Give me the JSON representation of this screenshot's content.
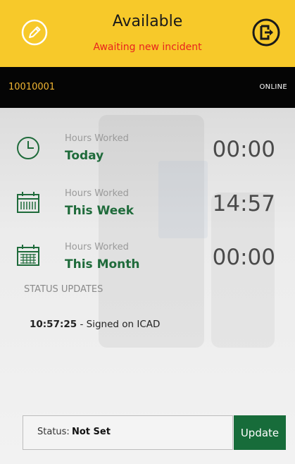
{
  "header": {
    "title": "Available",
    "subtitle": "Awaiting new incident",
    "left_icon": "pencil-icon",
    "right_icon": "sign-out-icon"
  },
  "unit_bar": {
    "unit_id": "10010001",
    "connection_status": "ONLINE"
  },
  "stats": [
    {
      "label": "Hours Worked",
      "period": "Today",
      "value": "00:00",
      "icon": "clock-icon"
    },
    {
      "label": "Hours Worked",
      "period": "This Week",
      "value": "14:57",
      "icon": "calendar-week-icon"
    },
    {
      "label": "Hours Worked",
      "period": "This Month",
      "value": "00:00",
      "icon": "calendar-month-icon"
    }
  ],
  "status_updates": {
    "title": "STATUS UPDATES",
    "items": [
      {
        "time": "10:57:25",
        "separator": " - ",
        "text": "Signed on ICAD"
      }
    ]
  },
  "status_bar": {
    "prefix": "Status: ",
    "value": "Not Set",
    "button_label": "Update"
  },
  "colors": {
    "header_bg": "#f7c92a",
    "subtitle": "#e8231e",
    "id_bar_bg": "#050505",
    "unit_id": "#f2b632",
    "period_text": "#1f6b3b",
    "update_button": "#176c3a"
  }
}
